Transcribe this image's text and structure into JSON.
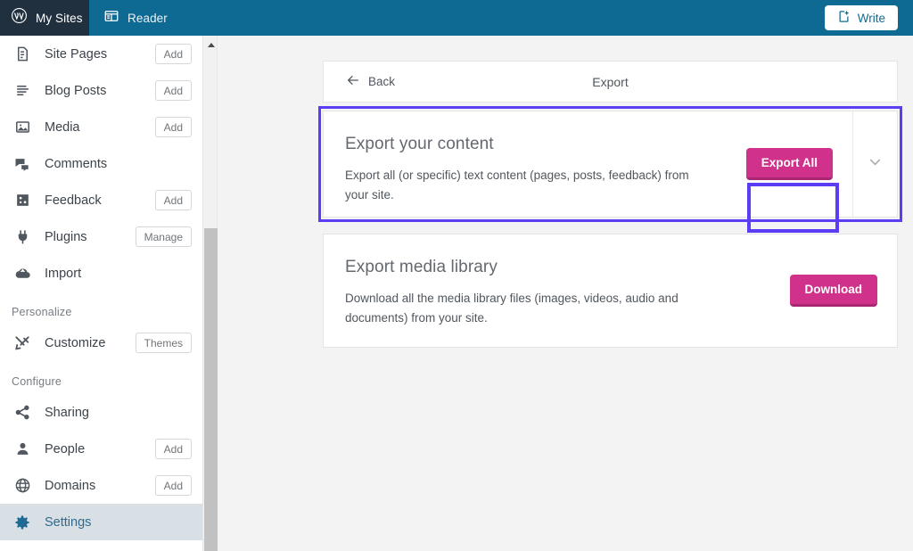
{
  "masthead": {
    "my_sites_label": "My Sites",
    "my_sites_icon": "wordpress-logo-icon",
    "reader_label": "Reader",
    "reader_icon": "reader-layout-icon",
    "write_label": "Write",
    "write_icon": "write-page-plus-icon",
    "bg_color": "#0f6a93",
    "my_sites_bg_color": "#21303f"
  },
  "sidebar": {
    "items": [
      {
        "label": "Site Pages",
        "icon": "page-icon",
        "action": "Add",
        "active": false
      },
      {
        "label": "Blog Posts",
        "icon": "posts-icon",
        "action": "Add",
        "active": false
      },
      {
        "label": "Media",
        "icon": "media-icon",
        "action": "Add",
        "active": false
      },
      {
        "label": "Comments",
        "icon": "comments-icon",
        "action": "",
        "active": false
      },
      {
        "label": "Feedback",
        "icon": "feedback-icon",
        "action": "Add",
        "active": false
      },
      {
        "label": "Plugins",
        "icon": "plugin-icon",
        "action": "Manage",
        "active": false
      },
      {
        "label": "Import",
        "icon": "import-cloud-icon",
        "action": "",
        "active": false
      }
    ],
    "section_personalize": "Personalize",
    "personalize_items": [
      {
        "label": "Customize",
        "icon": "customize-tools-icon",
        "action": "Themes",
        "active": false
      }
    ],
    "section_configure": "Configure",
    "configure_items": [
      {
        "label": "Sharing",
        "icon": "share-icon",
        "action": "",
        "active": false
      },
      {
        "label": "People",
        "icon": "person-icon",
        "action": "Add",
        "active": false
      },
      {
        "label": "Domains",
        "icon": "globe-icon",
        "action": "Add",
        "active": false
      },
      {
        "label": "Settings",
        "icon": "gear-icon",
        "action": "",
        "active": true
      }
    ],
    "active_bg_color": "#d8dfe5",
    "active_text_color": "#2e6a8e"
  },
  "scrollbar": {
    "up_arrow_icon": "scroll-up-arrow-icon",
    "thumb_color": "#c1c1c1",
    "track_color": "#f1f1f1"
  },
  "header": {
    "back_label": "Back",
    "back_icon": "arrow-left-icon",
    "title": "Export"
  },
  "cards": [
    {
      "id": "export-content",
      "title": "Export your content",
      "description": "Export all (or specific) text content (pages, posts, feedback) from your site.",
      "button_label": "Export All",
      "has_chevron": true,
      "chevron_icon": "chevron-down-icon",
      "highlighted": true
    },
    {
      "id": "export-media",
      "title": "Export media library",
      "description": "Download all the media library files (images, videos, audio and documents) from your site.",
      "button_label": "Download",
      "has_chevron": false,
      "chevron_icon": "",
      "highlighted": false
    }
  ],
  "colors": {
    "highlight_purple": "#5b3df5",
    "button_pink": "#d0318a",
    "button_pink_shadow": "#a92670",
    "page_background": "#f3f3f4",
    "card_border": "#e3e4e6"
  }
}
